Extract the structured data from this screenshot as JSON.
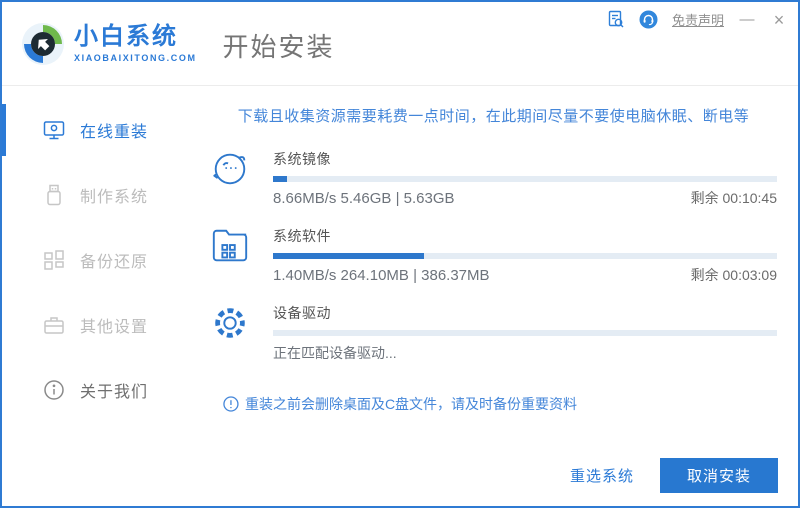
{
  "header": {
    "brand_name": "小白系统",
    "brand_domain": "XIAOBAIXITONG.COM",
    "page_title": "开始安装",
    "controls": {
      "doc_icon": "document-search-icon",
      "support_icon": "customer-support-icon",
      "disclaimer_label": "免责声明",
      "minimize_label": "—",
      "close_label": "×"
    }
  },
  "sidebar": {
    "items": [
      {
        "label": "在线重装",
        "icon": "monitor-icon",
        "active": true
      },
      {
        "label": "制作系统",
        "icon": "usb-drive-icon",
        "active": false
      },
      {
        "label": "备份还原",
        "icon": "backup-blocks-icon",
        "active": false
      },
      {
        "label": "其他设置",
        "icon": "toolbox-icon",
        "active": false
      },
      {
        "label": "关于我们",
        "icon": "info-circle-icon",
        "active": false
      }
    ]
  },
  "main": {
    "warning": "下载且收集资源需要耗费一点时间，在此期间尽量不要使电脑休眠、断电等",
    "tasks": [
      {
        "title": "系统镜像",
        "icon": "mascot-face-icon",
        "progress_percent": 2.8,
        "stats": "8.66MB/s 5.46GB | 5.63GB",
        "remaining": "剩余 00:10:45"
      },
      {
        "title": "系统软件",
        "icon": "folder-apps-icon",
        "progress_percent": 30,
        "stats": "1.40MB/s 264.10MB | 386.37MB",
        "remaining": "剩余 00:03:09"
      },
      {
        "title": "设备驱动",
        "icon": "gear-icon",
        "progress_percent": 0,
        "stats": "正在匹配设备驱动...",
        "remaining": ""
      }
    ],
    "bottom_notice": "重装之前会删除桌面及C盘文件，请及时备份重要资料"
  },
  "footer": {
    "reselect_label": "重选系统",
    "cancel_label": "取消安装"
  },
  "colors": {
    "accent_blue": "#2b7ad6",
    "progress_fill": "#2e78cc",
    "progress_track": "#e4ecf4",
    "notice_blue": "#4486d9",
    "border_blue": "#2f7bd3"
  }
}
